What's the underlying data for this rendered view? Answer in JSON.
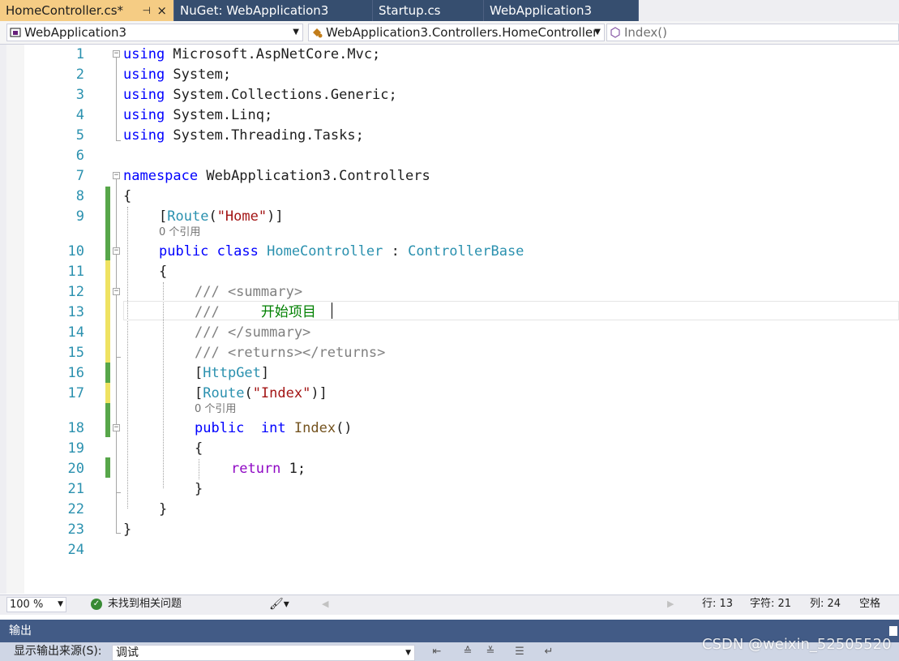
{
  "tabs": [
    {
      "label": "HomeController.cs*",
      "active": true,
      "pin": "⊣",
      "close": "×"
    },
    {
      "label": "NuGet: WebApplication3"
    },
    {
      "label": "Startup.cs"
    },
    {
      "label": "WebApplication3"
    }
  ],
  "navbar": {
    "project": "WebApplication3",
    "type": "WebApplication3.Controllers.HomeController",
    "member": "Index()"
  },
  "editor": {
    "line_numbers": [
      "1",
      "2",
      "3",
      "4",
      "5",
      "6",
      "7",
      "8",
      "9",
      "10",
      "11",
      "12",
      "13",
      "14",
      "15",
      "16",
      "17",
      "18",
      "19",
      "20",
      "21",
      "22",
      "23",
      "24"
    ],
    "code_lens": "0 个引用",
    "lines": [
      [
        "using",
        " Microsoft.AspNetCore.Mvc;"
      ],
      [
        "using",
        " System;"
      ],
      [
        "using",
        " System.Collections.Generic;"
      ],
      [
        "using",
        " System.Linq;"
      ],
      [
        "using",
        " System.Threading.Tasks;"
      ],
      [
        "namespace",
        " WebApplication3.Controllers"
      ],
      [
        "{"
      ],
      [
        "[",
        "Route",
        "(",
        "\"Home\"",
        ")]"
      ],
      [
        "public",
        " ",
        "class",
        " ",
        "HomeController",
        " : ",
        "ControllerBase"
      ],
      [
        "{"
      ],
      [
        "/// <summary>"
      ],
      [
        "///     ",
        "开始项目"
      ],
      [
        "/// </summary>"
      ],
      [
        "/// <returns></returns>"
      ],
      [
        "[",
        "HttpGet",
        "]"
      ],
      [
        "[",
        "Route",
        "(",
        "\"Index\"",
        ")]"
      ],
      [
        "public",
        "  ",
        "int",
        " ",
        "Index",
        "()"
      ],
      [
        "{"
      ],
      [
        "return",
        " 1;"
      ],
      [
        "}"
      ],
      [
        "}"
      ],
      [
        "}"
      ]
    ]
  },
  "status": {
    "zoom": "100 %",
    "issues": "未找到相关问题",
    "line": "行: 13",
    "char": "字符: 21",
    "col": "列: 24",
    "whitespace": "空格"
  },
  "output": {
    "title": "输出",
    "source_label": "显示输出来源(S):",
    "source_value": "调试"
  },
  "watermark": "CSDN @weixin_52505520",
  "colors": {
    "keyword": "#0000ff",
    "type": "#2b91af",
    "string": "#a31515",
    "comment": "#808080",
    "control_keyword": "#8f08c4",
    "method": "#74531f",
    "active_tab": "#f5cc84",
    "inactive_tab": "#364e6f",
    "saved_change": "#57a64a",
    "unsaved_change": "#efe262"
  }
}
